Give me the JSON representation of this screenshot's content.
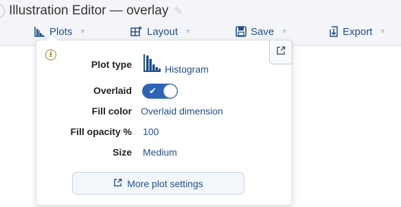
{
  "window": {
    "title": "Illustration Editor — overlay"
  },
  "menus": [
    {
      "label": "Plots"
    },
    {
      "label": "Layout"
    },
    {
      "label": "Save"
    },
    {
      "label": "Export"
    }
  ],
  "popover": {
    "rows": [
      {
        "label": "Plot type",
        "value": "Histogram"
      },
      {
        "label": "Overlaid",
        "value": ""
      },
      {
        "label": "Fill color",
        "value": "Overlaid dimension"
      },
      {
        "label": "Fill opacity %",
        "value": "100"
      },
      {
        "label": "Size",
        "value": "Medium"
      }
    ],
    "overlaid_on": true,
    "more_button": "More plot settings"
  },
  "colors": {
    "accent": "#1f4f8a",
    "toggle": "#2c65b4",
    "info": "#a57e19"
  },
  "icons": [
    "pencil-icon",
    "histogram-icon",
    "layout-icon",
    "save-icon",
    "export-icon",
    "info-icon",
    "popout-icon",
    "external-link-icon",
    "check-icon"
  ]
}
